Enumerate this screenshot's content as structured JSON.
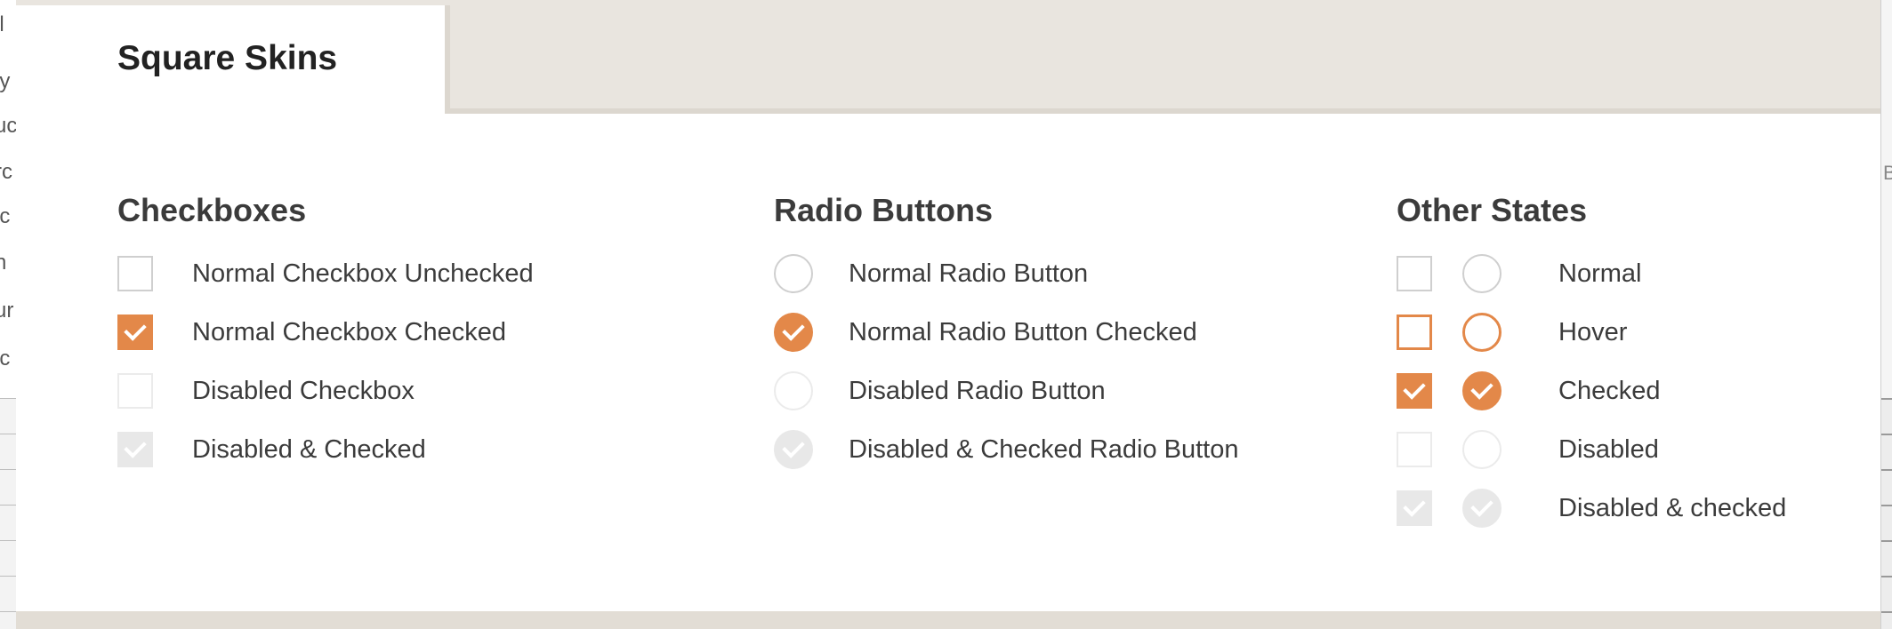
{
  "background_window": {
    "left_fragments": [
      "il",
      "ly",
      "uc",
      "rc",
      "ic",
      "n",
      "ur",
      "ic"
    ],
    "right_fragment": "B"
  },
  "tab": {
    "title": "Square Skins"
  },
  "columns": {
    "checkboxes": {
      "heading": "Checkboxes",
      "items": [
        {
          "label": "Normal Checkbox Unchecked",
          "state": "normal"
        },
        {
          "label": "Normal Checkbox Checked",
          "state": "checked"
        },
        {
          "label": "Disabled Checkbox",
          "state": "disabled"
        },
        {
          "label": "Disabled & Checked",
          "state": "disabled-checked"
        }
      ]
    },
    "radios": {
      "heading": "Radio Buttons",
      "items": [
        {
          "label": "Normal Radio Button",
          "state": "normal"
        },
        {
          "label": "Normal Radio Button Checked",
          "state": "checked"
        },
        {
          "label": "Disabled Radio Button",
          "state": "disabled"
        },
        {
          "label": "Disabled & Checked Radio Button",
          "state": "disabled-checked"
        }
      ]
    },
    "other": {
      "heading": "Other States",
      "items": [
        {
          "label": "Normal",
          "state": "normal"
        },
        {
          "label": "Hover",
          "state": "hover"
        },
        {
          "label": "Checked",
          "state": "checked"
        },
        {
          "label": "Disabled",
          "state": "disabled"
        },
        {
          "label": "Disabled & checked",
          "state": "disabled-checked"
        }
      ]
    }
  },
  "colors": {
    "accent": "#e38849",
    "border": "#cfcfcf",
    "disabled_fill": "#e8e8e8",
    "text": "#3b3b3b"
  }
}
